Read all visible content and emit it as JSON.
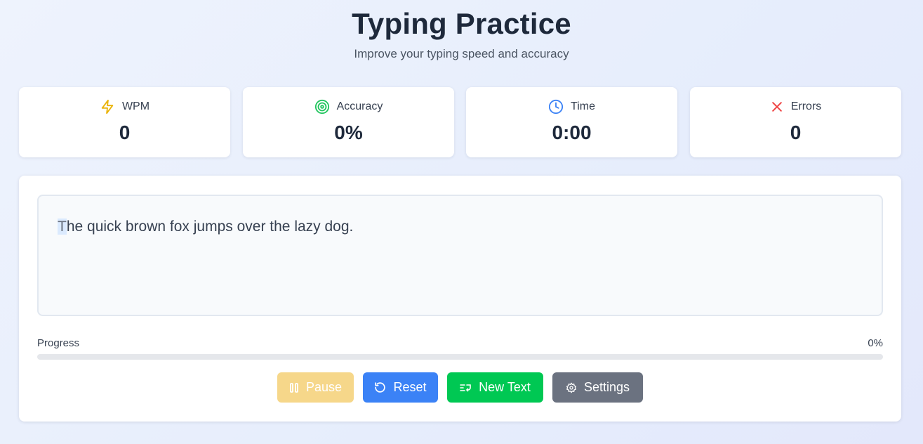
{
  "header": {
    "title": "Typing Practice",
    "subtitle": "Improve your typing speed and accuracy"
  },
  "stats": [
    {
      "label": "WPM",
      "value": "0",
      "icon": "lightning-icon",
      "color": "#eab308"
    },
    {
      "label": "Accuracy",
      "value": "0%",
      "icon": "target-icon",
      "color": "#22c55e"
    },
    {
      "label": "Time",
      "value": "0:00",
      "icon": "clock-icon",
      "color": "#3b82f6"
    },
    {
      "label": "Errors",
      "value": "0",
      "icon": "x-icon",
      "color": "#ef4444"
    }
  ],
  "practice": {
    "cursor_char": "T",
    "rest_text": "he quick brown fox jumps over the lazy dog."
  },
  "progress": {
    "label": "Progress",
    "value_text": "0%",
    "fraction": 0
  },
  "buttons": {
    "pause": {
      "label": "Pause",
      "color": "#f6d78a"
    },
    "reset": {
      "label": "Reset",
      "color": "#3b82f6"
    },
    "new_text": {
      "label": "New Text",
      "color": "#00c853"
    },
    "settings": {
      "label": "Settings",
      "color": "#6b7280"
    }
  }
}
